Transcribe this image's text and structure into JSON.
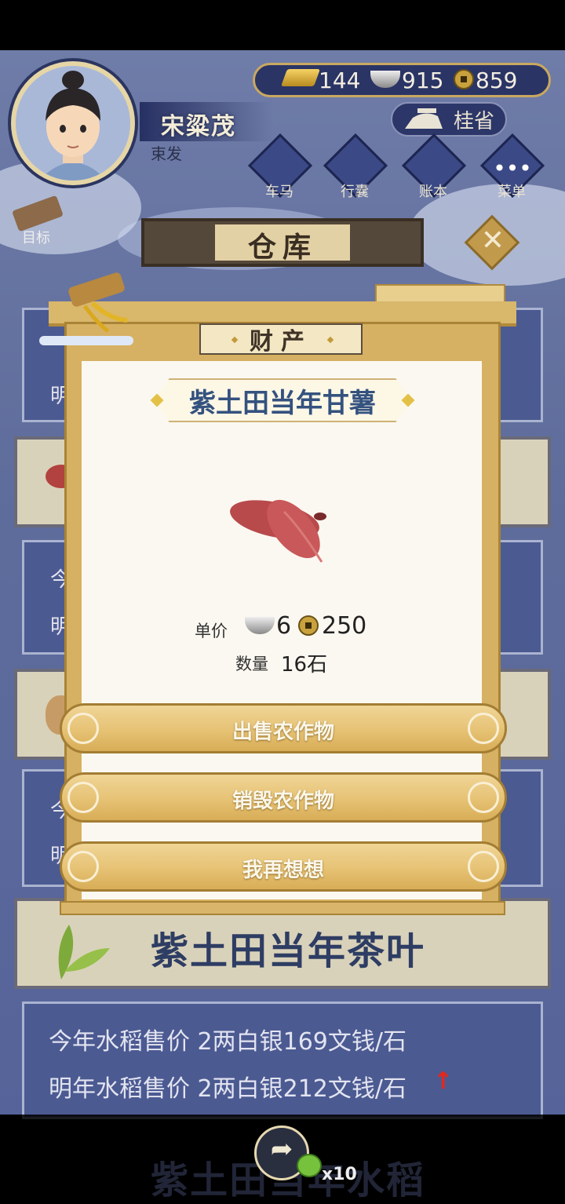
{
  "player": {
    "name": "宋粱茂",
    "title": "束发"
  },
  "currency": {
    "gold": "144",
    "silver": "915",
    "copper": "859"
  },
  "region": "桂省",
  "menu": [
    "车马",
    "行囊",
    "账本",
    "菜单"
  ],
  "goal_label": "目标",
  "warehouse_title": "仓库",
  "bg_list": {
    "peek": [
      "明",
      "今",
      "明",
      "今",
      "明"
    ],
    "tea_label": "紫土田当年茶叶",
    "rice_price_this_year": "今年水稻售价 2两白银169文钱/石",
    "rice_price_next_year": "明年水稻售价 2两白银212文钱/石",
    "next_card_label": "紫土田当年水稻"
  },
  "share_count": "x10",
  "modal": {
    "tab": "财产",
    "item_name": "紫土田当年甘薯",
    "unit_price_label": "单价",
    "price_silver": "6",
    "price_copper": "250",
    "quantity_label": "数量",
    "quantity_value": "16石",
    "buttons": {
      "sell": "出售农作物",
      "destroy": "销毁农作物",
      "cancel": "我再想想"
    }
  },
  "colors": {
    "accent_gold": "#d8ad57",
    "item_name_blue": "#34527f",
    "price_up_red": "#e4281d"
  }
}
